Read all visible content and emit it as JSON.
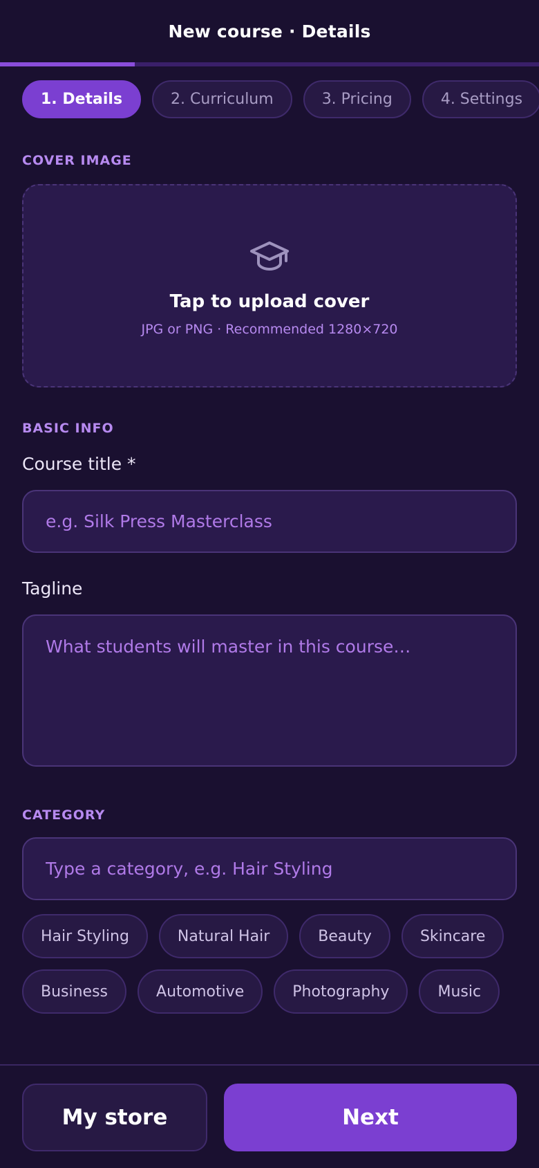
{
  "header": {
    "title": "New course · Details",
    "progress_fraction": 0.25
  },
  "steps": [
    {
      "label": "1. Details",
      "active": true
    },
    {
      "label": "2. Curriculum",
      "active": false
    },
    {
      "label": "3. Pricing",
      "active": false
    },
    {
      "label": "4. Settings",
      "active": false
    }
  ],
  "cover": {
    "section_label": "COVER IMAGE",
    "icon": "graduation-cap-icon",
    "title": "Tap to upload cover",
    "hint": "JPG or PNG · Recommended 1280×720"
  },
  "basic_info": {
    "section_label": "BASIC INFO",
    "course_title_label": "Course title *",
    "course_title_value": "",
    "course_title_placeholder": "e.g. Silk Press Masterclass",
    "tagline_label": "Tagline",
    "tagline_value": "",
    "tagline_placeholder": "What students will master in this course…"
  },
  "category": {
    "section_label": "CATEGORY",
    "input_value": "",
    "input_placeholder": "Type a category, e.g. Hair Styling",
    "chips": [
      "Hair Styling",
      "Natural Hair",
      "Beauty",
      "Skincare",
      "Business",
      "Automotive",
      "Photography",
      "Music"
    ]
  },
  "footer": {
    "store_label": "My store",
    "next_label": "Next"
  },
  "colors": {
    "background": "#1a1030",
    "accent": "#7b3fd1",
    "label": "#b78af0",
    "surface": "#2a1a4c"
  }
}
